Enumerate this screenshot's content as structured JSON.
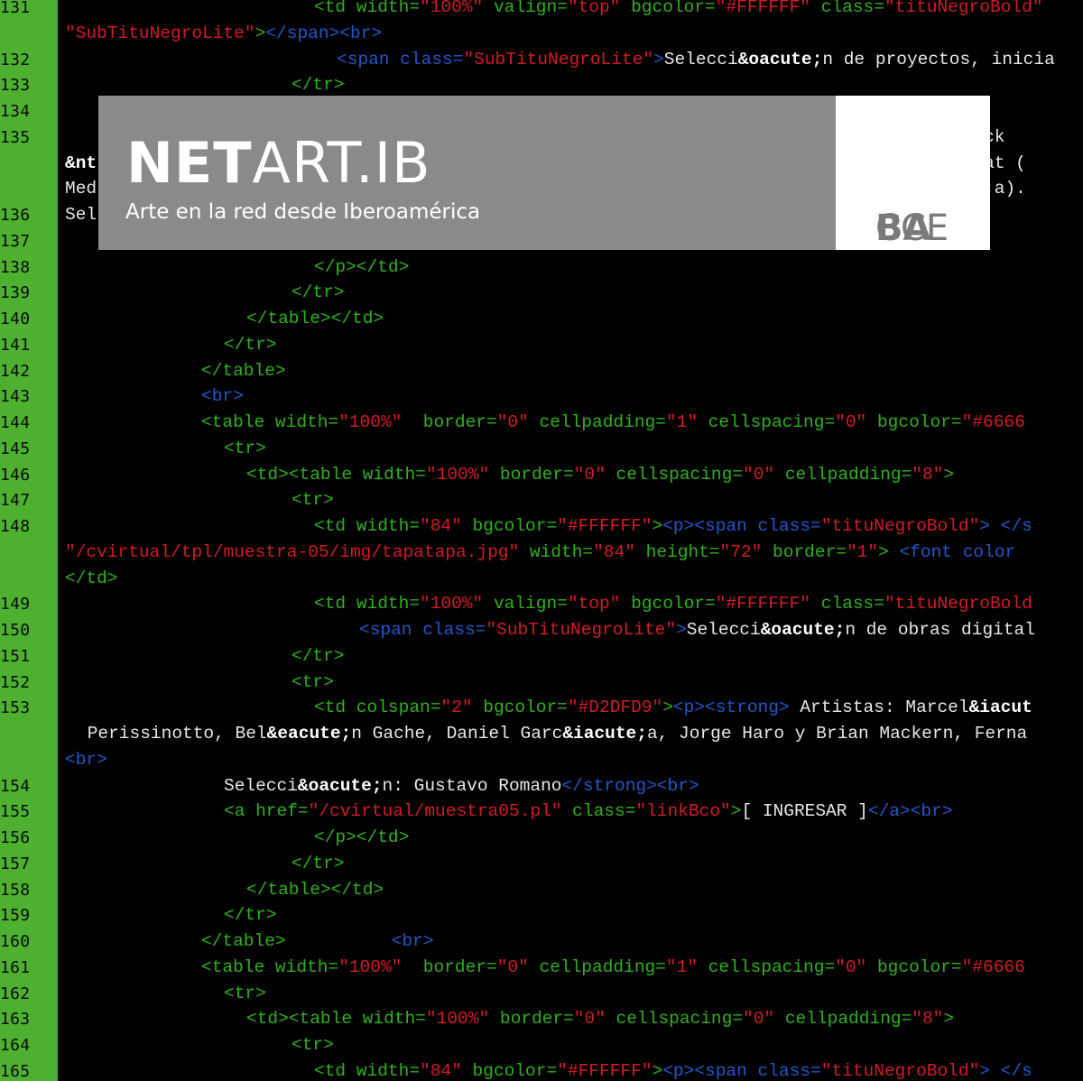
{
  "gutter": {
    "line_numbers": [
      "131",
      "",
      "132",
      "133",
      "134",
      "135",
      "",
      "",
      "136",
      "137",
      "138",
      "139",
      "140",
      "141",
      "142",
      "143",
      "144",
      "145",
      "146",
      "147",
      "148",
      "",
      "",
      "149",
      "150",
      "151",
      "152",
      "153",
      "",
      "",
      "154",
      "155",
      "156",
      "157",
      "158",
      "159",
      "160",
      "161",
      "162",
      "163",
      "164",
      "165"
    ]
  },
  "code_lines": [
    [
      [
        "t-tag",
        "<td "
      ],
      [
        "t-attr",
        "width="
      ],
      [
        "t-str",
        "\"100%\""
      ],
      [
        "t-attr",
        " valign="
      ],
      [
        "t-str",
        "\"top\""
      ],
      [
        "t-attr",
        " bgcolor="
      ],
      [
        "t-str",
        "\"#FFFFFF\""
      ],
      [
        "t-attr",
        " class="
      ],
      [
        "t-str",
        "\"tituNegroBold\""
      ]
    ],
    [
      [
        "t-str",
        "\"SubTituNegroLite\""
      ],
      [
        "t-tag",
        ">"
      ],
      [
        "t-blue",
        "</span><br>"
      ]
    ],
    [
      [
        "t-blue",
        "<span "
      ],
      [
        "t-blue",
        "class="
      ],
      [
        "t-str",
        "\"SubTituNegroLite\""
      ],
      [
        "t-blue",
        ">"
      ],
      [
        "t-white",
        "Selecci"
      ],
      [
        "t-bold",
        "&oacute;"
      ],
      [
        "t-white",
        "n de proyectos, inicia"
      ]
    ],
    [
      [
        "t-tag",
        "</tr>"
      ]
    ],
    [],
    [
      [
        "t-white",
        "                                                                                  derhack"
      ]
    ],
    [
      [
        "t-bold",
        "&nt"
      ],
      [
        "t-white",
        "                                                                               Fadaiat ("
      ]
    ],
    [
      [
        "t-white",
        "Med"
      ],
      [
        "t-white",
        "                                                                               "
      ],
      [
        "t-bold",
        "tilde"
      ],
      [
        "t-white",
        ";a)."
      ]
    ],
    [
      [
        "t-white",
        "Sel"
      ],
      [
        "t-white",
        "                                                                               "
      ],
      [
        "t-blue",
        ">"
      ]
    ],
    [],
    [
      [
        "t-tag",
        "</p></td>"
      ]
    ],
    [
      [
        "t-tag",
        "</tr>"
      ]
    ],
    [
      [
        "t-tag",
        "</table></td>"
      ]
    ],
    [
      [
        "t-tag",
        "</tr>"
      ]
    ],
    [
      [
        "t-tag",
        "</table>"
      ]
    ],
    [
      [
        "t-blue",
        "<br>"
      ]
    ],
    [
      [
        "t-tag",
        "<table "
      ],
      [
        "t-attr",
        "width="
      ],
      [
        "t-str",
        "\"100%\""
      ],
      [
        "t-attr",
        "  border="
      ],
      [
        "t-str",
        "\"0\""
      ],
      [
        "t-attr",
        " cellpadding="
      ],
      [
        "t-str",
        "\"1\""
      ],
      [
        "t-attr",
        " cellspacing="
      ],
      [
        "t-str",
        "\"0\""
      ],
      [
        "t-attr",
        " bgcolor="
      ],
      [
        "t-str",
        "\"#6666"
      ]
    ],
    [
      [
        "t-tag",
        "<tr>"
      ]
    ],
    [
      [
        "t-tag",
        "<td><table "
      ],
      [
        "t-attr",
        "width="
      ],
      [
        "t-str",
        "\"100%\""
      ],
      [
        "t-attr",
        " border="
      ],
      [
        "t-str",
        "\"0\""
      ],
      [
        "t-attr",
        " cellspacing="
      ],
      [
        "t-str",
        "\"0\""
      ],
      [
        "t-attr",
        " cellpadding="
      ],
      [
        "t-str",
        "\"8\""
      ],
      [
        "t-tag",
        ">"
      ]
    ],
    [
      [
        "t-tag",
        "<tr>"
      ]
    ],
    [
      [
        "t-tag",
        "<td "
      ],
      [
        "t-attr",
        "width="
      ],
      [
        "t-str",
        "\"84\""
      ],
      [
        "t-attr",
        " bgcolor="
      ],
      [
        "t-str",
        "\"#FFFFFF\""
      ],
      [
        "t-tag",
        ">"
      ],
      [
        "t-blue",
        "<p><span "
      ],
      [
        "t-blue",
        "class="
      ],
      [
        "t-str",
        "\"tituNegroBold\""
      ],
      [
        "t-blue",
        "> </s"
      ]
    ],
    [
      [
        "t-str",
        "\"/cvirtual/tpl/muestra-05/img/tapatapa.jpg\""
      ],
      [
        "t-attr",
        " width="
      ],
      [
        "t-str",
        "\"84\""
      ],
      [
        "t-attr",
        " height="
      ],
      [
        "t-str",
        "\"72\""
      ],
      [
        "t-attr",
        " border="
      ],
      [
        "t-str",
        "\"1\""
      ],
      [
        "t-tag",
        ">"
      ],
      [
        "t-blue",
        " <font color"
      ]
    ],
    [
      [
        "t-tag",
        "</td>"
      ]
    ],
    [
      [
        "t-tag",
        "<td "
      ],
      [
        "t-attr",
        "width="
      ],
      [
        "t-str",
        "\"100%\""
      ],
      [
        "t-attr",
        " valign="
      ],
      [
        "t-str",
        "\"top\""
      ],
      [
        "t-attr",
        " bgcolor="
      ],
      [
        "t-str",
        "\"#FFFFFF\""
      ],
      [
        "t-attr",
        " class="
      ],
      [
        "t-str",
        "\"tituNegroBold"
      ]
    ],
    [
      [
        "t-blue",
        "<span "
      ],
      [
        "t-blue",
        "class="
      ],
      [
        "t-str",
        "\"SubTituNegroLite\""
      ],
      [
        "t-blue",
        ">"
      ],
      [
        "t-white",
        "Selecci"
      ],
      [
        "t-bold",
        "&oacute;"
      ],
      [
        "t-white",
        "n de obras digital"
      ]
    ],
    [
      [
        "t-tag",
        "</tr>"
      ]
    ],
    [
      [
        "t-tag",
        "<tr>"
      ]
    ],
    [
      [
        "t-tag",
        "<td "
      ],
      [
        "t-attr",
        "colspan="
      ],
      [
        "t-str",
        "\"2\""
      ],
      [
        "t-attr",
        " bgcolor="
      ],
      [
        "t-str",
        "\"#D2DFD9\""
      ],
      [
        "t-tag",
        ">"
      ],
      [
        "t-blue",
        "<p><strong>"
      ],
      [
        "t-white",
        " Artistas: Marcel"
      ],
      [
        "t-bold",
        "&iacut"
      ]
    ],
    [
      [
        "t-white",
        " Perissinotto, Bel"
      ],
      [
        "t-bold",
        "&eacute;"
      ],
      [
        "t-white",
        "n Gache, Daniel Garc"
      ],
      [
        "t-bold",
        "&iacute;"
      ],
      [
        "t-white",
        "a, Jorge Haro y Brian Mackern, Ferna"
      ]
    ],
    [
      [
        "t-blue",
        "<br>"
      ]
    ],
    [
      [
        "t-white",
        "Selecci"
      ],
      [
        "t-bold",
        "&oacute;"
      ],
      [
        "t-white",
        "n: Gustavo Romano"
      ],
      [
        "t-blue",
        "</strong><br>"
      ]
    ],
    [
      [
        "t-tag",
        "<a "
      ],
      [
        "t-attr",
        "href="
      ],
      [
        "t-str",
        "\"/cvirtual/muestra05.pl\""
      ],
      [
        "t-attr",
        " class="
      ],
      [
        "t-str",
        "\"linkBco\""
      ],
      [
        "t-tag",
        ">"
      ],
      [
        "t-white",
        "[ INGRESAR ]"
      ],
      [
        "t-blue",
        "</a><br>"
      ]
    ],
    [
      [
        "t-tag",
        "</p></td>"
      ]
    ],
    [
      [
        "t-tag",
        "</tr>"
      ]
    ],
    [
      [
        "t-tag",
        "</table></td>"
      ]
    ],
    [
      [
        "t-tag",
        "</tr>"
      ]
    ],
    [
      [
        "t-tag",
        "</table>"
      ],
      [
        "t-white",
        "          "
      ],
      [
        "t-blue",
        "<br>"
      ]
    ],
    [
      [
        "t-tag",
        "<table "
      ],
      [
        "t-attr",
        "width="
      ],
      [
        "t-str",
        "\"100%\""
      ],
      [
        "t-attr",
        "  border="
      ],
      [
        "t-str",
        "\"0\""
      ],
      [
        "t-attr",
        " cellpadding="
      ],
      [
        "t-str",
        "\"1\""
      ],
      [
        "t-attr",
        " cellspacing="
      ],
      [
        "t-str",
        "\"0\""
      ],
      [
        "t-attr",
        " bgcolor="
      ],
      [
        "t-str",
        "\"#6666"
      ]
    ],
    [
      [
        "t-tag",
        "<tr>"
      ]
    ],
    [
      [
        "t-tag",
        "<td><table "
      ],
      [
        "t-attr",
        "width="
      ],
      [
        "t-str",
        "\"100%\""
      ],
      [
        "t-attr",
        " border="
      ],
      [
        "t-str",
        "\"0\""
      ],
      [
        "t-attr",
        " cellspacing="
      ],
      [
        "t-str",
        "\"0\""
      ],
      [
        "t-attr",
        " cellpadding="
      ],
      [
        "t-str",
        "\"8\""
      ],
      [
        "t-tag",
        ">"
      ]
    ],
    [
      [
        "t-tag",
        "<tr>"
      ]
    ],
    [
      [
        "t-tag",
        "<td "
      ],
      [
        "t-attr",
        "width="
      ],
      [
        "t-str",
        "\"84\""
      ],
      [
        "t-attr",
        " bgcolor="
      ],
      [
        "t-str",
        "\"#FFFFFF\""
      ],
      [
        "t-tag",
        ">"
      ],
      [
        "t-blue",
        "<p><span "
      ],
      [
        "t-blue",
        "class="
      ],
      [
        "t-str",
        "\"tituNegroBold\""
      ],
      [
        "t-blue",
        "> </s"
      ]
    ]
  ],
  "banner": {
    "logo_bold": "NET",
    "logo_light": "ART.IB",
    "tagline": "Arte en la red desde Iberoamérica",
    "partner_light": "CCE",
    "partner_bold": "BA"
  },
  "colors": {
    "gutter": "#4db12f",
    "editor_bg": "#000000",
    "tag_green": "#2eb21a",
    "string_red": "#d31b24",
    "keyword_blue": "#2257c9",
    "banner_grey": "#8a8a8a"
  }
}
